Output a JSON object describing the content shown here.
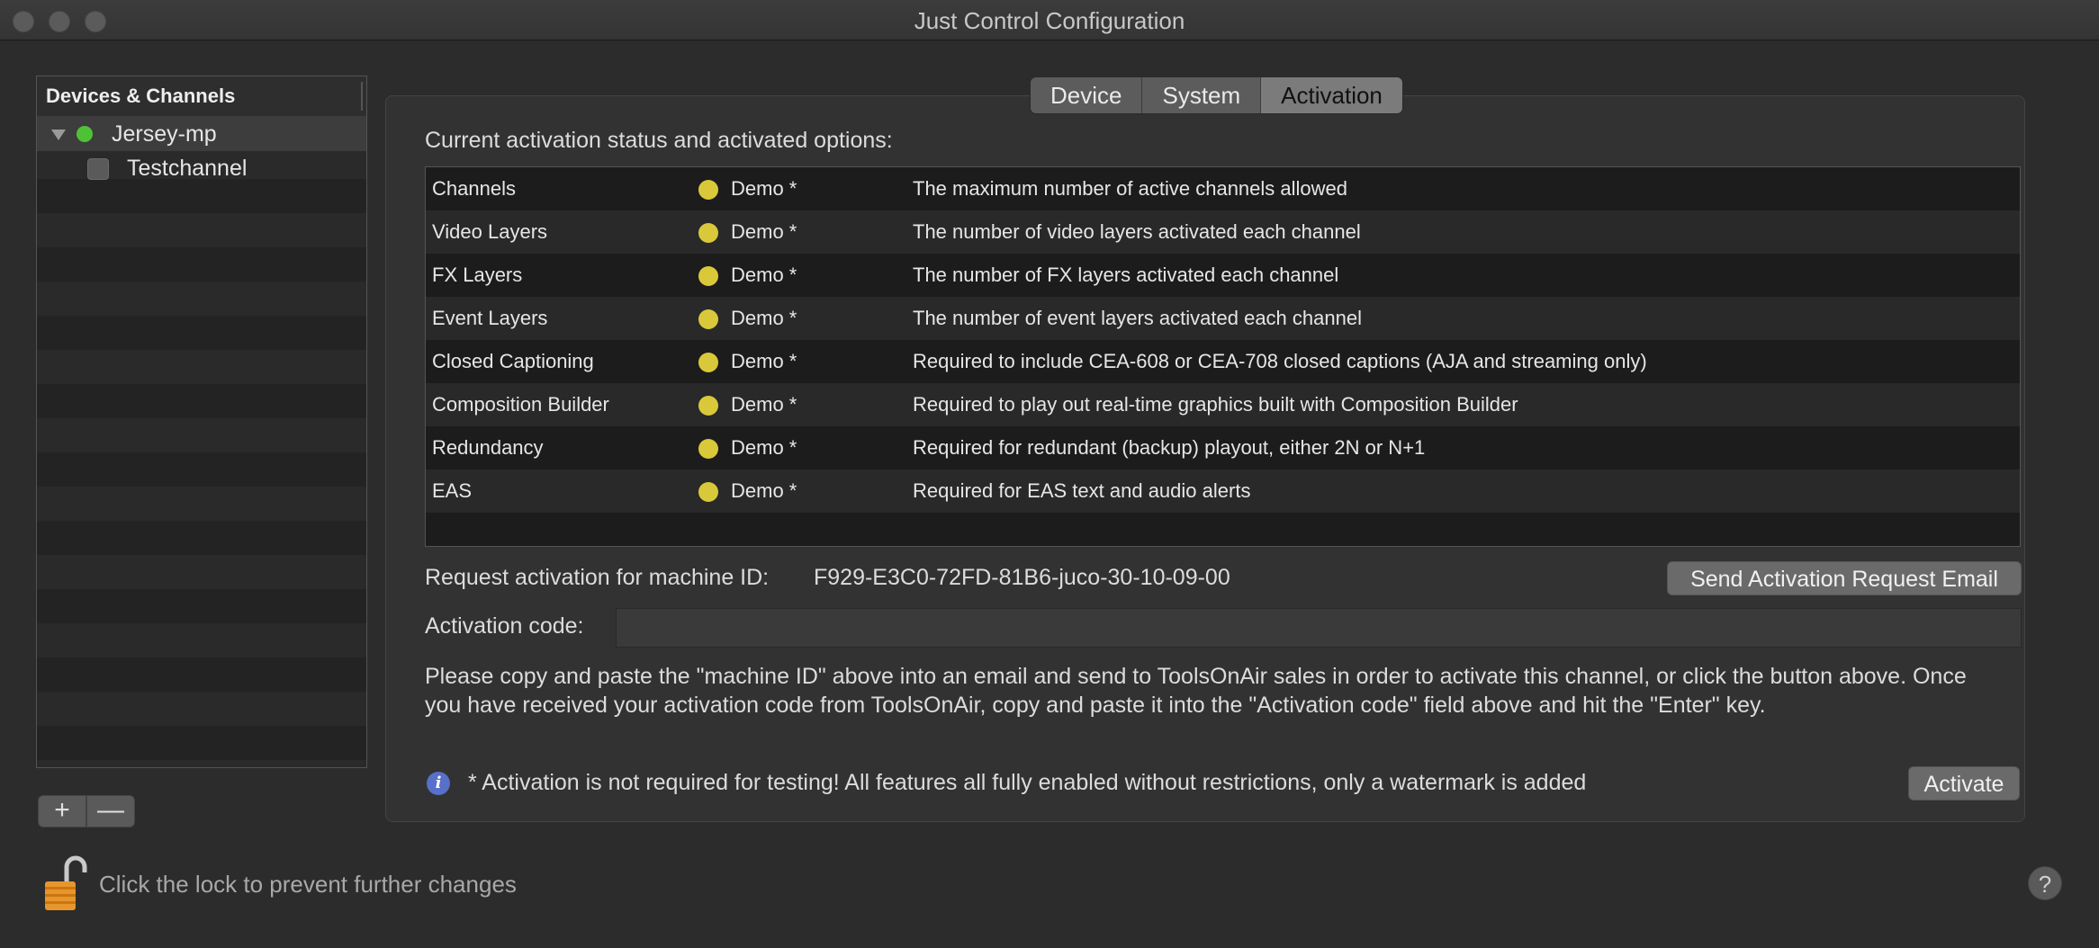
{
  "window": {
    "title": "Just Control Configuration"
  },
  "sidebar": {
    "header": "Devices & Channels",
    "device": {
      "name": "Jersey-mp",
      "status_color": "#4fc137"
    },
    "channel": {
      "name": "Testchannel"
    },
    "add_label": "+",
    "remove_label": "—"
  },
  "tabs": [
    {
      "label": "Device"
    },
    {
      "label": "System"
    },
    {
      "label": "Activation",
      "active": true
    }
  ],
  "activation": {
    "section_label": "Current activation status and activated options:",
    "rows": [
      {
        "name": "Channels",
        "status": "Demo *",
        "desc": "The maximum number of active channels allowed"
      },
      {
        "name": "Video Layers",
        "status": "Demo *",
        "desc": "The number of video layers activated each channel"
      },
      {
        "name": "FX Layers",
        "status": "Demo *",
        "desc": "The number of FX layers activated each channel"
      },
      {
        "name": "Event Layers",
        "status": "Demo *",
        "desc": "The number of event layers activated each channel"
      },
      {
        "name": "Closed Captioning",
        "status": "Demo *",
        "desc": "Required to include CEA-608 or CEA-708 closed captions (AJA and streaming only)"
      },
      {
        "name": "Composition Builder",
        "status": "Demo *",
        "desc": "Required to play out real-time graphics built with Composition Builder"
      },
      {
        "name": "Redundancy",
        "status": "Demo *",
        "desc": "Required for redundant (backup) playout, either 2N or N+1"
      },
      {
        "name": "EAS",
        "status": "Demo *",
        "desc": "Required for EAS text and audio alerts"
      }
    ],
    "status_color": "#d9c93a",
    "machine_label": "Request activation for machine ID:",
    "machine_id": "F929-E3C0-72FD-81B6-juco-30-10-09-00",
    "send_button": "Send Activation Request Email",
    "code_label": "Activation code:",
    "code_value": "",
    "instructions": "Please copy and paste the \"machine ID\" above into an email and send to ToolsOnAir sales in order to activate this channel, or click the button above. Once you have received your activation code from ToolsOnAir, copy and paste it into the \"Activation code\" field above and hit the \"Enter\" key.",
    "info_glyph": "i",
    "note": "* Activation is not required for testing! All features all fully enabled without restrictions, only a watermark is added",
    "activate_button": "Activate"
  },
  "footer": {
    "lock_text": "Click the lock to prevent further changes",
    "help_label": "?"
  }
}
